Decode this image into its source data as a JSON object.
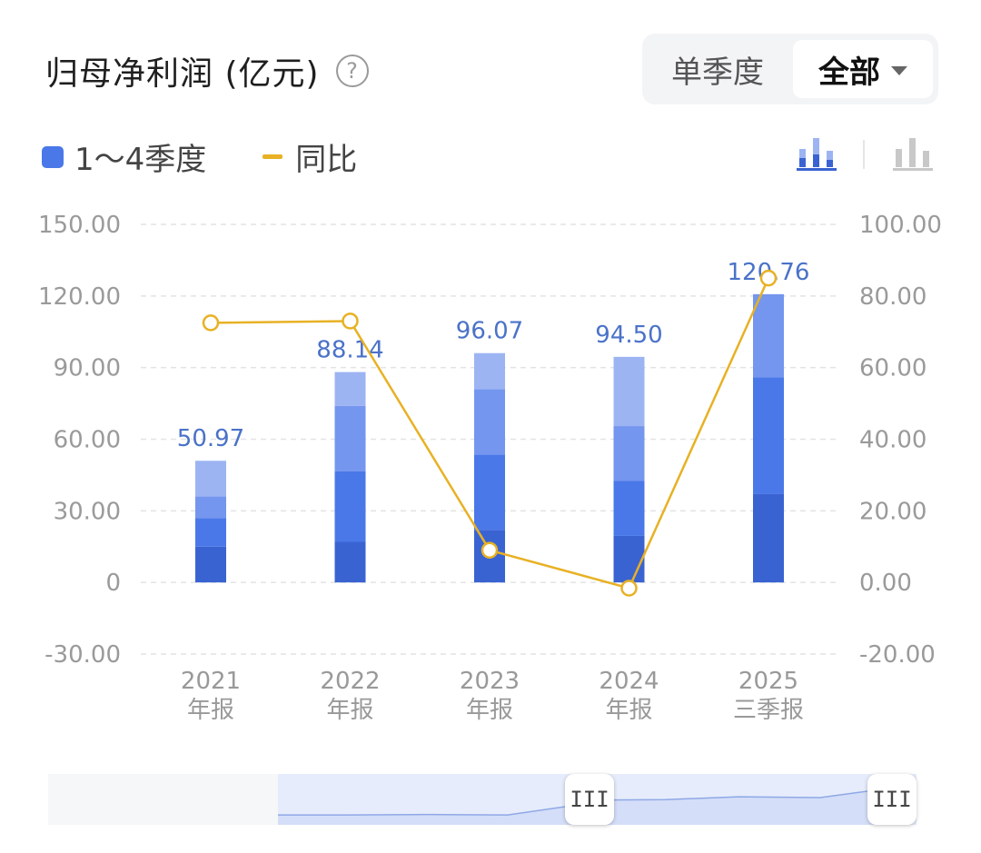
{
  "header": {
    "title": "归母净利润 (亿元)",
    "help_icon": "?",
    "toggle_option_1": "单季度",
    "toggle_option_2": "全部"
  },
  "legend": {
    "bars_label": "1～4季度",
    "line_label": "同比"
  },
  "colors": {
    "q1": "#3a63d2",
    "q2": "#4a78e8",
    "q3": "#7496ee",
    "q4": "#9db4f3",
    "line": "#e8b124",
    "value_label": "#4a72c8"
  },
  "chart_data": {
    "type": "bar",
    "stacked": true,
    "categories": [
      [
        "2021",
        "年报"
      ],
      [
        "2022",
        "年报"
      ],
      [
        "2023",
        "年报"
      ],
      [
        "2024",
        "年报"
      ],
      [
        "2025",
        "三季报"
      ]
    ],
    "series": [
      {
        "values": [
          15.0,
          17.0,
          22.0,
          19.5,
          37.0
        ]
      },
      {
        "values": [
          12.0,
          29.5,
          31.5,
          23.0,
          49.0
        ]
      },
      {
        "values": [
          9.0,
          27.5,
          27.5,
          23.0,
          34.76
        ]
      },
      {
        "values": [
          14.97,
          14.14,
          15.07,
          29.0,
          0
        ]
      }
    ],
    "totals": [
      "50.97",
      "88.14",
      "96.07",
      "94.50",
      "120.76"
    ],
    "yoy_series": {
      "values": [
        72.5,
        73.0,
        9.0,
        -1.6,
        85.0
      ]
    },
    "left_axis": {
      "ticks": [
        "150.00",
        "120.00",
        "90.00",
        "60.00",
        "30.00",
        "0",
        "-30.00"
      ],
      "ylim": [
        -30,
        150
      ]
    },
    "right_axis": {
      "ticks": [
        "100.00",
        "80.00",
        "60.00",
        "40.00",
        "20.00",
        "0.00",
        "-20.00"
      ],
      "ylim": [
        -20,
        100
      ]
    },
    "grid": true
  },
  "scroller": {
    "handle_left": "III",
    "handle_right": "III",
    "preview_values": [
      51,
      51,
      52,
      51,
      88,
      89,
      96,
      94,
      120
    ]
  }
}
